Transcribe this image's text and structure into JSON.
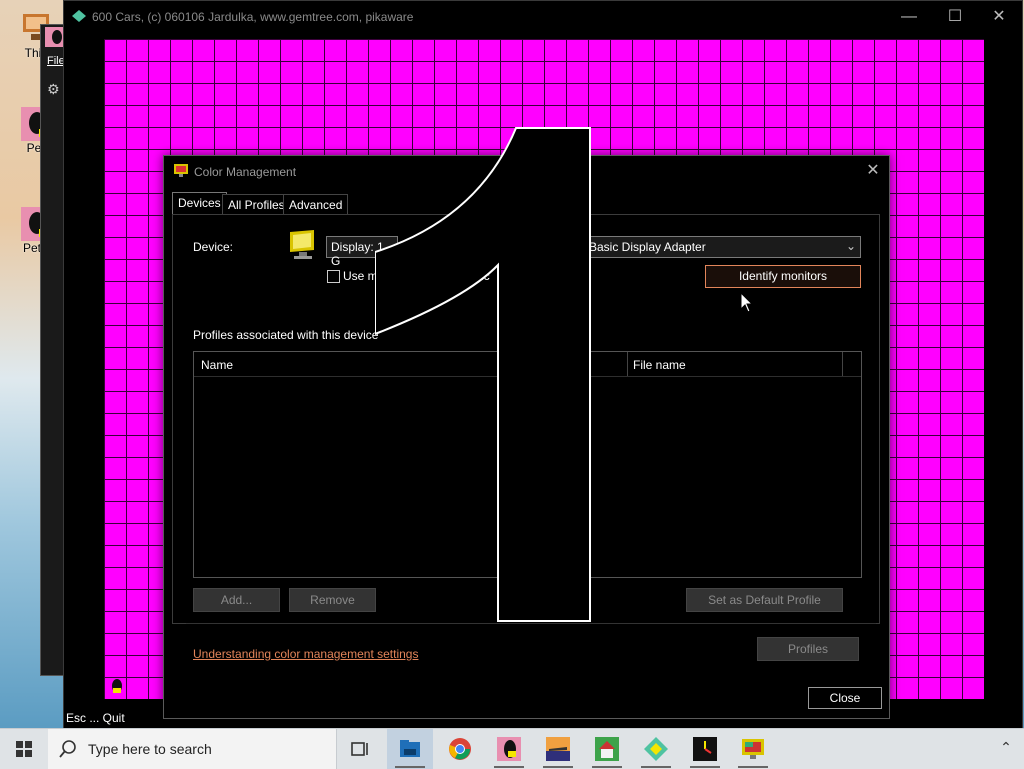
{
  "desktop": {
    "icons": [
      {
        "label": "This"
      },
      {
        "label": "Pe"
      },
      {
        "label": "Petr"
      }
    ],
    "back_window": {
      "menu_label": "File"
    }
  },
  "game_window": {
    "title": "600 Cars, (c) 060106 Jardulka, www.gemtree.com, pikaware",
    "minimize_glyph": "—",
    "maximize_glyph": "☐",
    "close_glyph": "✕",
    "status_text": "Esc ... Quit",
    "canvas_color": "#ff00ff"
  },
  "color_management": {
    "title": "Color Management",
    "close_glyph": "✕",
    "tabs": [
      {
        "label": "Devices",
        "active": true
      },
      {
        "label": "All Profiles",
        "active": false
      },
      {
        "label": "Advanced",
        "active": false
      }
    ],
    "device_label": "Device:",
    "device_select_left": "Display: 1. G",
    "device_select_right": "Basic Display Adapter",
    "use_my_settings_label": "Use m",
    "use_my_settings_tail": "ic",
    "identify_button": "Identify monitors",
    "profiles_label": "Profiles associated with this device",
    "list_headers": {
      "name": "Name",
      "file_name": "File name"
    },
    "buttons": {
      "add": "Add...",
      "remove": "Remove",
      "set_default": "Set as Default Profile",
      "profiles": "Profiles",
      "close": "Close"
    },
    "link": "Understanding color management settings",
    "overlay_number": "1"
  },
  "taskbar": {
    "search_placeholder": "Type here to search",
    "apps": [
      {
        "icon": "task-view-icon"
      },
      {
        "icon": "file-explorer-icon"
      },
      {
        "icon": "chrome-icon"
      },
      {
        "icon": "petr-game-icon"
      },
      {
        "icon": "plane-game-icon"
      },
      {
        "icon": "house-game-icon"
      },
      {
        "icon": "cars-game-icon"
      },
      {
        "icon": "clock-app-icon"
      },
      {
        "icon": "color-management-icon"
      }
    ]
  }
}
